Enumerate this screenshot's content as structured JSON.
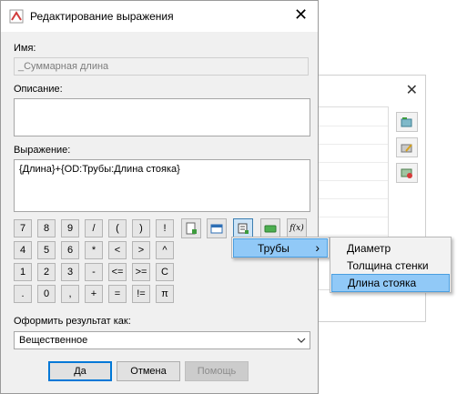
{
  "dialog": {
    "title": "Редактирование выражения",
    "name_label": "Имя:",
    "name_value": "_Суммарная длина",
    "description_label": "Описание:",
    "description_value": "",
    "expression_label": "Выражение:",
    "expression_value": "{Длина}+{OD:Трубы:Длина стояка}",
    "keypad": [
      [
        "7",
        "8",
        "9",
        "/",
        "(",
        ")",
        "!"
      ],
      [
        "4",
        "5",
        "6",
        "*",
        "<",
        ">",
        "^"
      ],
      [
        "1",
        "2",
        "3",
        "-",
        "<=",
        ">=",
        "C"
      ],
      [
        ".",
        "0",
        ",",
        "+",
        "=",
        "!=",
        "π"
      ]
    ],
    "toolbar_icons": [
      "insert-property-icon",
      "insert-format-icon",
      "insert-field-icon",
      "insert-variable-icon",
      "function-icon"
    ],
    "function_glyph": "f(x)",
    "format_label": "Оформить результат как:",
    "format_value": "Вещественное",
    "buttons": {
      "ok": "Да",
      "cancel": "Отмена",
      "help": "Помощь"
    }
  },
  "submenu": {
    "item": "Трубы",
    "arrow": "›",
    "children": [
      "Диаметр",
      "Толщина стенки",
      "Длина стояка"
    ],
    "highlighted": "Длина стояка"
  },
  "background_window": {
    "close_glyph": "✕"
  },
  "close_glyph": "✕",
  "colors": {
    "highlight": "#91c9f7",
    "default_button_border": "#0078d7"
  }
}
